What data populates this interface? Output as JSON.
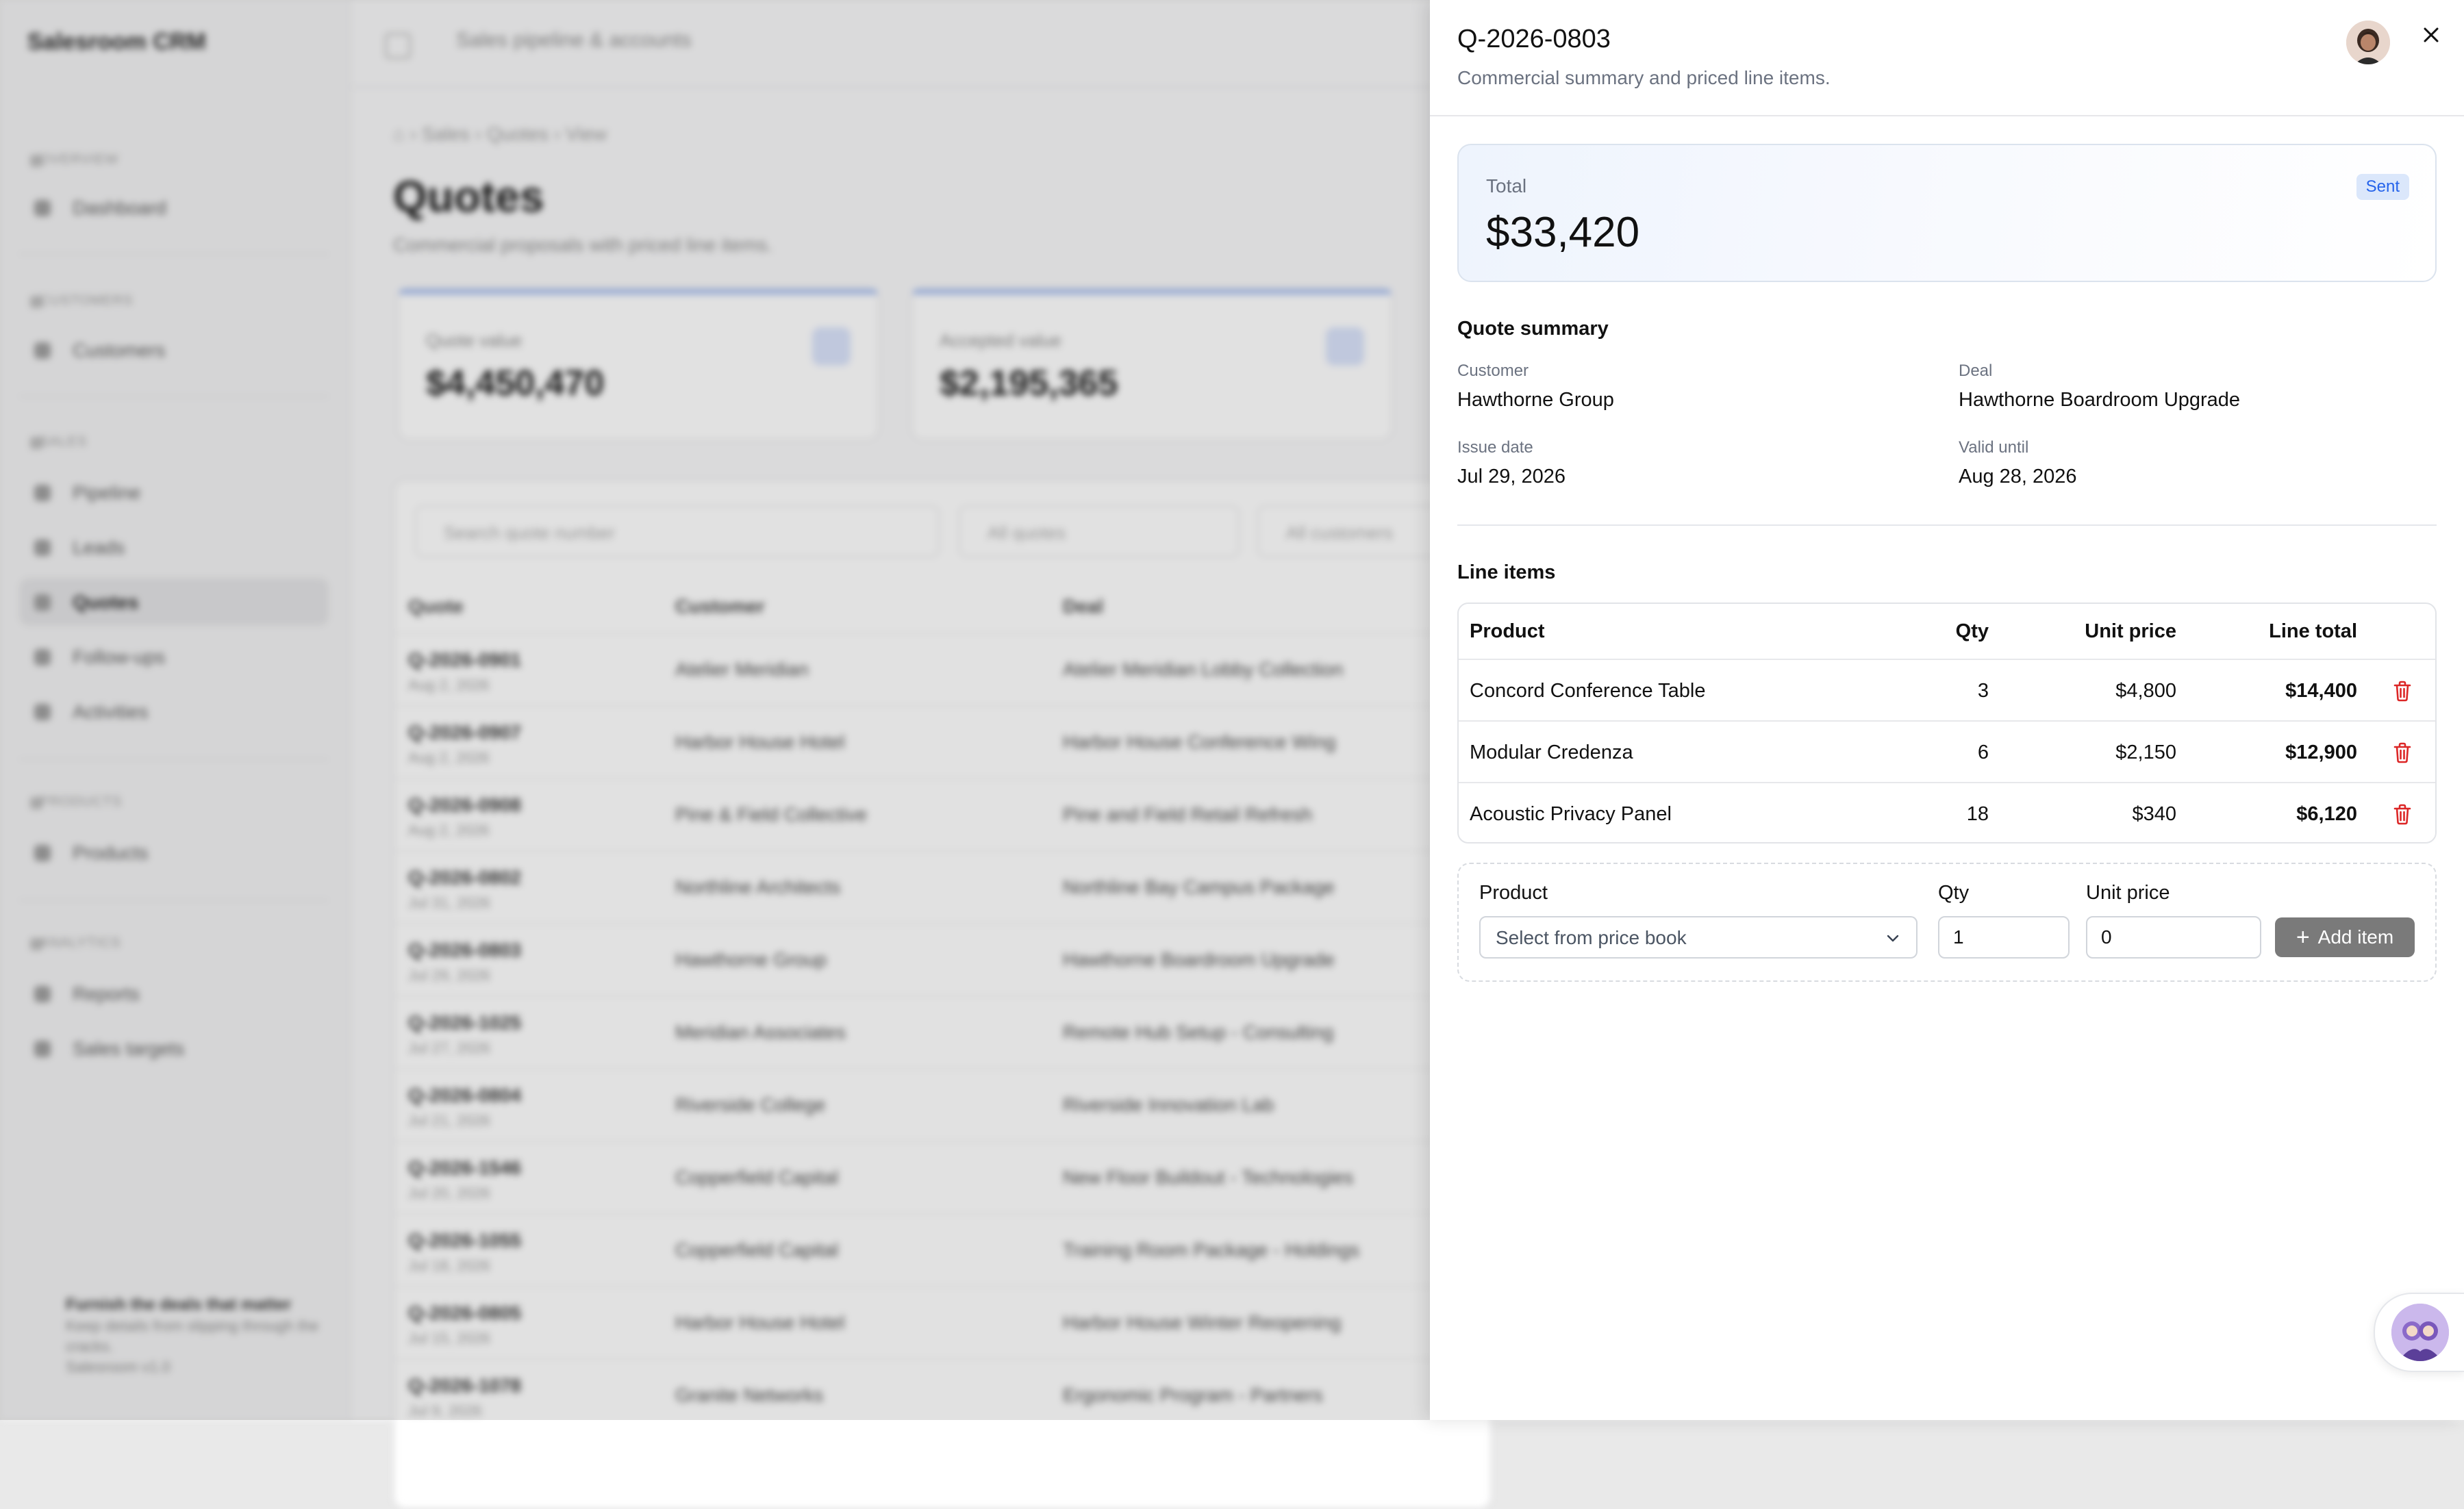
{
  "background": {
    "app_name": "Salesroom CRM",
    "topbar_title": "Sales pipeline & accounts",
    "sidebar": {
      "groups": [
        {
          "label": "OVERVIEW",
          "items": [
            {
              "label": "Dashboard",
              "active": false
            }
          ]
        },
        {
          "label": "CUSTOMERS",
          "items": [
            {
              "label": "Customers",
              "active": false
            }
          ]
        },
        {
          "label": "SALES",
          "items": [
            {
              "label": "Pipeline",
              "active": false
            },
            {
              "label": "Leads",
              "active": false
            },
            {
              "label": "Quotes",
              "active": true
            },
            {
              "label": "Follow-ups",
              "active": false
            },
            {
              "label": "Activities",
              "active": false
            }
          ]
        },
        {
          "label": "PRODUCTS",
          "items": [
            {
              "label": "Products",
              "active": false
            }
          ]
        },
        {
          "label": "ANALYTICS",
          "items": [
            {
              "label": "Reports",
              "active": false
            },
            {
              "label": "Sales targets",
              "active": false
            }
          ]
        }
      ],
      "promo": {
        "title": "Furnish the deals that matter",
        "text": "Keep details from slipping through the cracks.",
        "version": "Salesroom v1.0"
      }
    },
    "breadcrumb": [
      "Sales",
      "Quotes",
      "View"
    ],
    "page_title": "Quotes",
    "page_subtitle": "Commercial proposals with priced line items.",
    "stat_cards": [
      {
        "label": "Quote value",
        "value": "$4,450,470"
      },
      {
        "label": "Accepted value",
        "value": "$2,195,365"
      }
    ],
    "filters": {
      "search_placeholder": "Search quote number",
      "status": "All quotes",
      "customer": "All customers"
    },
    "table": {
      "columns": [
        "Quote",
        "Customer",
        "Deal"
      ],
      "rows": [
        {
          "quote": "Q-2026-0901",
          "date": "Aug 2, 2026",
          "customer": "Atelier Meridian",
          "deal": "Atelier Meridian Lobby Collection"
        },
        {
          "quote": "Q-2026-0907",
          "date": "Aug 2, 2026",
          "customer": "Harbor House Hotel",
          "deal": "Harbor House Conference Wing"
        },
        {
          "quote": "Q-2026-0908",
          "date": "Aug 2, 2026",
          "customer": "Pine & Field Collective",
          "deal": "Pine and Field Retail Refresh"
        },
        {
          "quote": "Q-2026-0802",
          "date": "Jul 31, 2026",
          "customer": "Northline Architects",
          "deal": "Northline Bay Campus Package"
        },
        {
          "quote": "Q-2026-0803",
          "date": "Jul 29, 2026",
          "customer": "Hawthorne Group",
          "deal": "Hawthorne Boardroom Upgrade"
        },
        {
          "quote": "Q-2026-1025",
          "date": "Jul 27, 2026",
          "customer": "Meridian Associates",
          "deal": "Remote Hub Setup - Consulting"
        },
        {
          "quote": "Q-2026-0804",
          "date": "Jul 21, 2026",
          "customer": "Riverside College",
          "deal": "Riverside Innovation Lab"
        },
        {
          "quote": "Q-2026-1546",
          "date": "Jul 20, 2026",
          "customer": "Copperfield Capital",
          "deal": "New Floor Buildout - Technologies"
        },
        {
          "quote": "Q-2026-1055",
          "date": "Jul 18, 2026",
          "customer": "Copperfield Capital",
          "deal": "Training Room Package - Holdings"
        },
        {
          "quote": "Q-2026-0805",
          "date": "Jul 15, 2026",
          "customer": "Harbor House Hotel",
          "deal": "Harbor House Winter Reopening"
        },
        {
          "quote": "Q-2026-1078",
          "date": "Jul 9, 2026",
          "customer": "Granite Networks",
          "deal": "Ergonomic Program - Partners"
        }
      ]
    }
  },
  "drawer": {
    "title": "Q-2026-0803",
    "subtitle": "Commercial summary and priced line items.",
    "total_label": "Total",
    "total_value": "$33,420",
    "status": "Sent",
    "summary": {
      "heading": "Quote summary",
      "customer_label": "Customer",
      "customer": "Hawthorne Group",
      "deal_label": "Deal",
      "deal": "Hawthorne Boardroom Upgrade",
      "issue_label": "Issue date",
      "issue_date": "Jul 29, 2026",
      "valid_label": "Valid until",
      "valid_until": "Aug 28, 2026"
    },
    "line_items": {
      "heading": "Line items",
      "columns": {
        "product": "Product",
        "qty": "Qty",
        "unit_price": "Unit price",
        "line_total": "Line total"
      },
      "rows": [
        {
          "product": "Concord Conference Table",
          "qty": "3",
          "unit_price": "$4,800",
          "line_total": "$14,400"
        },
        {
          "product": "Modular Credenza",
          "qty": "6",
          "unit_price": "$2,150",
          "line_total": "$12,900"
        },
        {
          "product": "Acoustic Privacy Panel",
          "qty": "18",
          "unit_price": "$340",
          "line_total": "$6,120"
        }
      ]
    },
    "add_item": {
      "product_label": "Product",
      "product_placeholder": "Select from price book",
      "qty_label": "Qty",
      "qty_value": "1",
      "unit_price_label": "Unit price",
      "unit_price_value": "0",
      "button_label": "Add item"
    }
  },
  "colors": {
    "accent": "#2563eb",
    "badge_bg": "#dbe7fb",
    "delete": "#dc2626",
    "button": "#7a7a7a"
  }
}
